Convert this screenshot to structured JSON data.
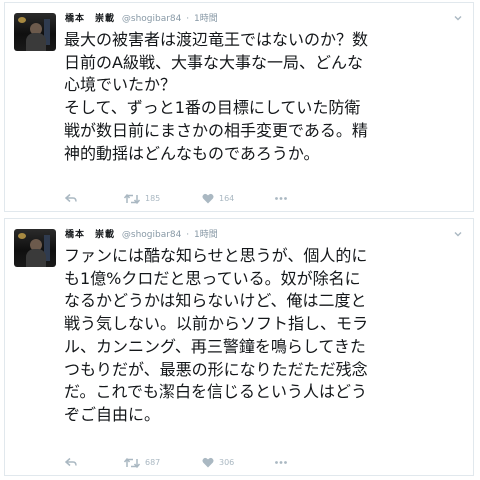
{
  "tweets": [
    {
      "name": "橋本　崇載",
      "handle": "@shogibar84",
      "separator": "·",
      "time": "1時間",
      "lines": [
        "最大の被害者は渡辺竜王ではないのか？数",
        "日前のA級戦、大事な大事な一局、どんな",
        "心境でいたか？",
        "そして、ずっと1番の目標にしていた防衛",
        "戦が数日前にまさかの相手変更である。精",
        "神的動揺はどんなものであろうか。"
      ],
      "retweets": "185",
      "likes": "164"
    },
    {
      "name": "橋本　崇載",
      "handle": "@shogibar84",
      "separator": "·",
      "time": "1時間",
      "lines": [
        "ファンには酷な知らせと思うが、個人的に",
        "も1億%クロだと思っている。奴が除名に",
        "なるかどうかは知らないけど、俺は二度と",
        "戦う気しない。以前からソフト指し、モラ",
        "ル、カンニング、再三警鐘を鳴らしてきた",
        "つもりだが、最悪の形になりただただ残念",
        "だ。これでも潔白を信じるという人はどう",
        "ぞご自由に。"
      ],
      "retweets": "687",
      "likes": "306"
    }
  ],
  "icons": {
    "reply": "reply-icon",
    "retweet": "retweet-icon",
    "like": "heart-icon",
    "more": "more-icon",
    "menu": "chevron-down-icon"
  },
  "colors": {
    "icon_gray": "#aab8c2",
    "meta_gray": "#8899a6",
    "border": "#e1e8ed"
  }
}
